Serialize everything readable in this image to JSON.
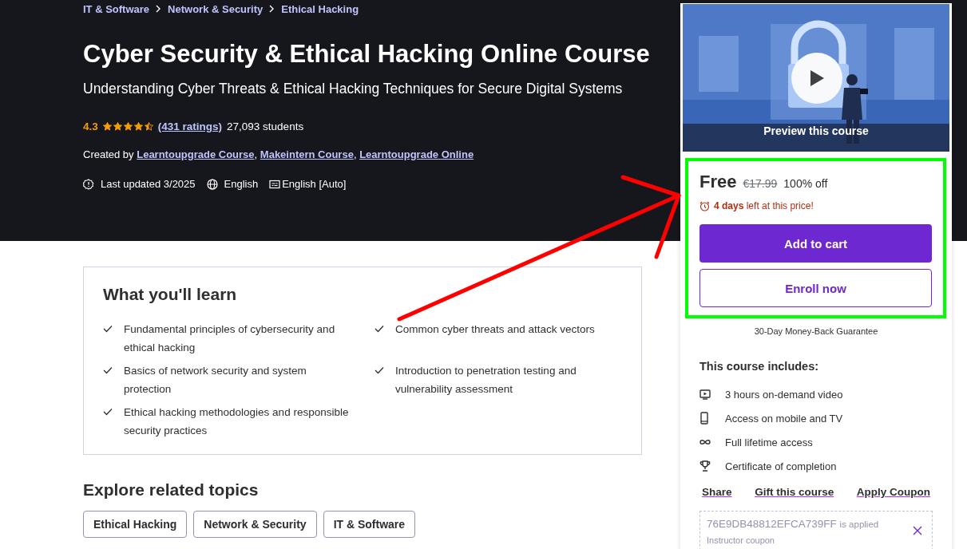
{
  "breadcrumbs": [
    "IT & Software",
    "Network & Security",
    "Ethical Hacking"
  ],
  "title": "Cyber Security & Ethical Hacking Online Course",
  "subtitle": "Understanding Cyber Threats & Ethical Hacking Techniques for Secure Digital Systems",
  "rating": {
    "score": "4.3",
    "stars": 4.5,
    "ratings_link": "(431 ratings)",
    "students": "27,093 students"
  },
  "created_by": {
    "label": "Created by",
    "separator": ",",
    "authors": [
      "Learntoupgrade Course",
      "Makeintern Course",
      "Learntoupgrade Online"
    ]
  },
  "meta": {
    "last_updated": "Last updated 3/2025",
    "language": "English",
    "captions": "English [Auto]"
  },
  "learn": {
    "heading": "What you'll learn",
    "items": [
      "Fundamental principles of cybersecurity and ethical hacking",
      "Common cyber threats and attack vectors",
      "Basics of network security and system protection",
      "Introduction to penetration testing and vulnerability assessment",
      "Ethical hacking methodologies and responsible security practices"
    ]
  },
  "related": {
    "heading": "Explore related topics",
    "tags": [
      "Ethical Hacking",
      "Network & Security",
      "IT & Software"
    ]
  },
  "sidebar": {
    "preview_label": "Preview this course",
    "price": "Free",
    "original_price": "€17.99",
    "discount": "100% off",
    "countdown_bold": "4 days",
    "countdown_rest": "left at this price!",
    "add_to_cart": "Add to cart",
    "enroll": "Enroll now",
    "guarantee": "30-Day Money-Back Guarantee",
    "includes_heading": "This course includes:",
    "includes": [
      {
        "kind": "video",
        "text": "3 hours on-demand video"
      },
      {
        "kind": "mobile",
        "text": "Access on mobile and TV"
      },
      {
        "kind": "infinity",
        "text": "Full lifetime access"
      },
      {
        "kind": "trophy",
        "text": "Certificate of completion"
      }
    ],
    "links": [
      "Share",
      "Gift this course",
      "Apply Coupon"
    ],
    "coupon": {
      "code": "76E9DB48812EFCA739FF",
      "status": "is applied",
      "note": "Instructor coupon"
    }
  }
}
